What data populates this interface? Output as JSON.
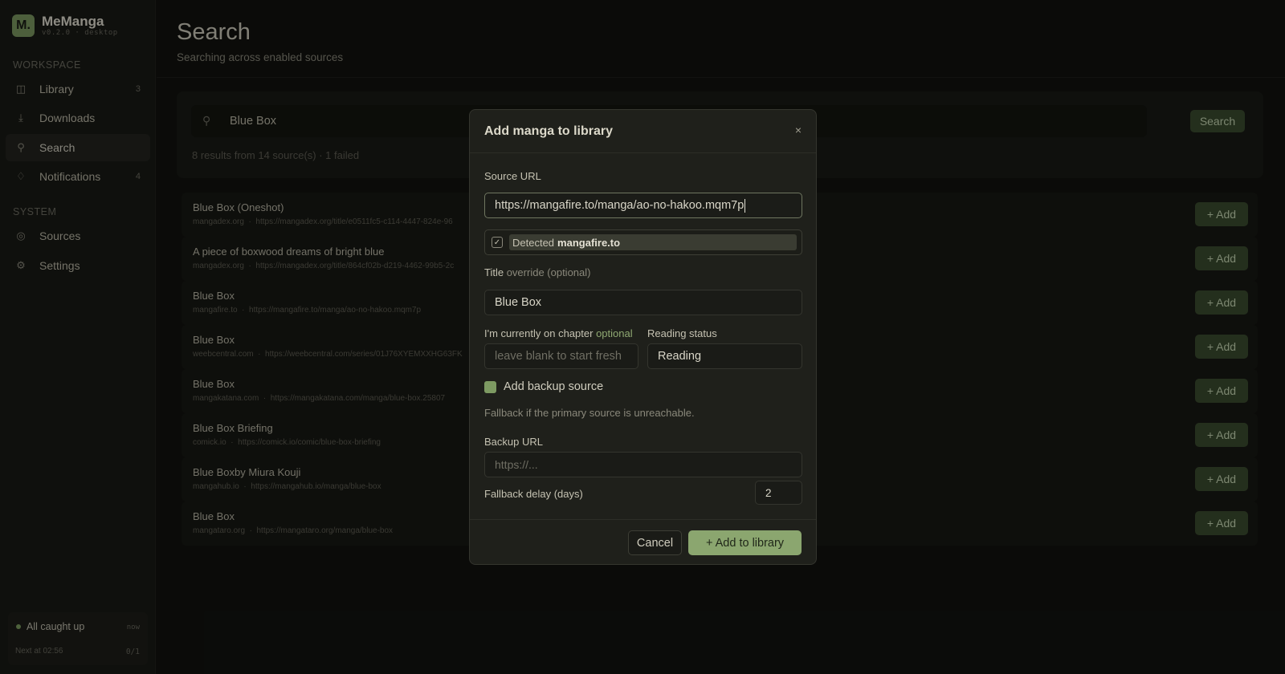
{
  "sidebar": {
    "brand_logo": "M.",
    "brand_name": "MeManga",
    "brand_version": "v0.2.0 · desktop",
    "workspace_label": "WORKSPACE",
    "system_label": "SYSTEM",
    "items": [
      {
        "label": "Library",
        "icon": "book-icon",
        "count": "3"
      },
      {
        "label": "Downloads",
        "icon": "download-icon",
        "count": ""
      },
      {
        "label": "Search",
        "icon": "search-icon",
        "count": ""
      },
      {
        "label": "Notifications",
        "icon": "bell-icon",
        "count": "4"
      },
      {
        "label": "Sources",
        "icon": "globe-icon",
        "count": ""
      },
      {
        "label": "Settings",
        "icon": "gear-icon",
        "count": ""
      }
    ],
    "status": {
      "text": "All caught up",
      "time": "now",
      "next": "Next at 02:56",
      "fraction": "0/1"
    }
  },
  "header": {
    "title": "Search",
    "subtitle": "Searching across enabled sources"
  },
  "search": {
    "query": "Blue Box",
    "button_label": "Search",
    "summary": "8 results from 14 source(s)  ·  1 failed"
  },
  "results": [
    {
      "title": "Blue Box (Oneshot)",
      "source": "mangadex.org",
      "url": "https://mangadex.org/title/e0511fc5-c114-4447-824e-96"
    },
    {
      "title": "A piece of boxwood dreams of bright blue",
      "source": "mangadex.org",
      "url": "https://mangadex.org/title/864cf02b-d219-4462-99b5-2c"
    },
    {
      "title": "Blue Box",
      "source": "mangafire.to",
      "url": "https://mangafire.to/manga/ao-no-hakoo.mqm7p"
    },
    {
      "title": "Blue Box",
      "source": "weebcentral.com",
      "url": "https://weebcentral.com/series/01J76XYEMXXHG63FK"
    },
    {
      "title": "Blue Box",
      "source": "mangakatana.com",
      "url": "https://mangakatana.com/manga/blue-box.25807"
    },
    {
      "title": "Blue Box Briefing",
      "source": "comick.io",
      "url": "https://comick.io/comic/blue-box-briefing"
    },
    {
      "title": "Blue Boxby Miura Kouji",
      "source": "mangahub.io",
      "url": "https://mangahub.io/manga/blue-box"
    },
    {
      "title": "Blue Box",
      "source": "mangataro.org",
      "url": "https://mangataro.org/manga/blue-box"
    }
  ],
  "add_button_label": "+ Add",
  "modal": {
    "title": "Add manga to library",
    "close": "×",
    "source_url_label": "Source URL",
    "source_url_value": "https://mangafire.to/manga/ao-no-hakoo.mqm7p",
    "detected_prefix": "Detected",
    "detected_source": "mangafire.to",
    "title_label": "Title",
    "title_label_suffix": "override (optional)",
    "title_value": "Blue Box",
    "chapter_label": "I'm currently on chapter",
    "chapter_label_suffix": "optional",
    "chapter_placeholder": "leave blank to start fresh",
    "status_label": "Reading status",
    "status_value": "Reading",
    "backup_label": "Add backup source",
    "backup_hint": "Fallback if the primary source is unreachable.",
    "backup_url_label": "Backup URL",
    "backup_url_placeholder": "https://...",
    "fallback_label": "Fallback delay (days)",
    "fallback_value": "2",
    "cancel_label": "Cancel",
    "submit_label": "+ Add to library"
  }
}
